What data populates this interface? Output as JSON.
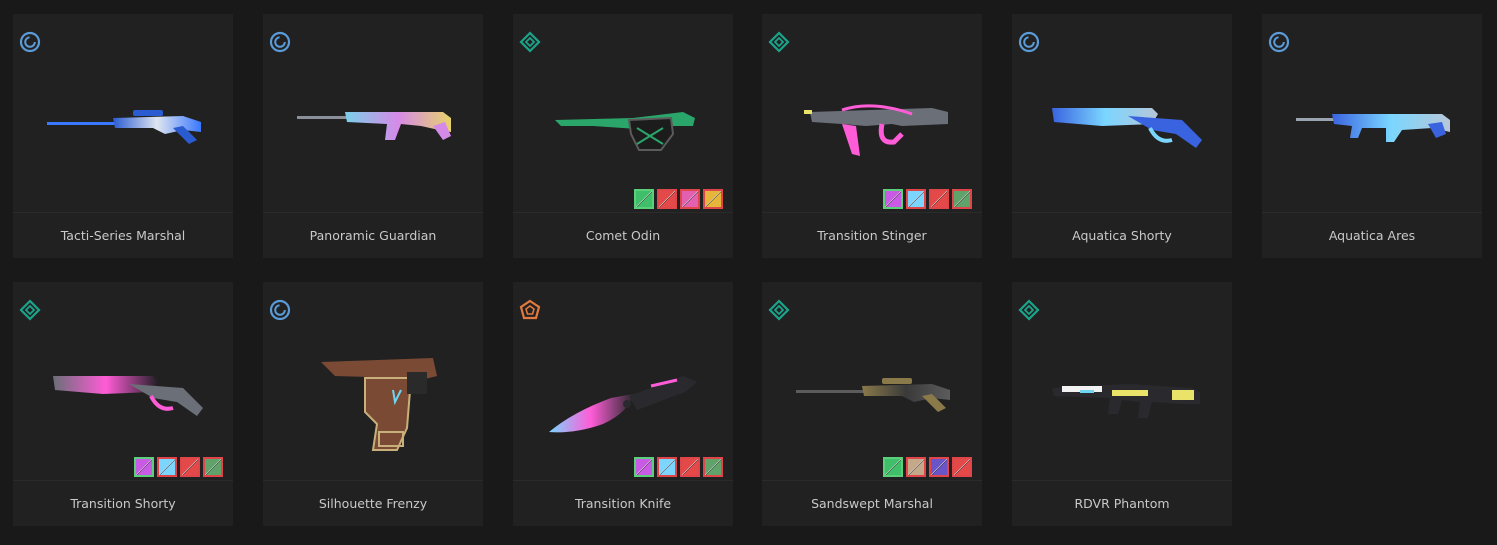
{
  "colors": {
    "background": "#1a1919",
    "card": "#222122",
    "tier_deluxe": "#5a9bd8",
    "tier_select": "#1aa58a",
    "tier_exclusive": "#e07a3e"
  },
  "skins": [
    {
      "name": "Tacti-Series Marshal",
      "tier_icon": "deluxe-tier-icon",
      "weapon_icon": "marshal-icon",
      "palette": [
        "#2a5bd0",
        "#dfe5f0",
        "#3a78ff"
      ],
      "swatches": []
    },
    {
      "name": "Panoramic Guardian",
      "tier_icon": "deluxe-tier-icon",
      "weapon_icon": "guardian-icon",
      "palette": [
        "#7ad0e8",
        "#d68ae8",
        "#e7d26a"
      ],
      "swatches": []
    },
    {
      "name": "Comet Odin",
      "tier_icon": "select-tier-icon",
      "weapon_icon": "odin-icon",
      "palette": [
        "#2aa66b",
        "#5b5b5b",
        "#1c1c1c"
      ],
      "swatches": [
        "#3fbf6a",
        "#e34949",
        "#e35fb0",
        "#e6b63a"
      ]
    },
    {
      "name": "Transition Stinger",
      "tier_icon": "select-tier-icon",
      "weapon_icon": "stinger-icon",
      "palette": [
        "#6a6f78",
        "#ff5cd7",
        "#1e1e22"
      ],
      "swatches": [
        "#c95ae5",
        "#7bd5ff",
        "#e34949",
        "#5fa26a"
      ]
    },
    {
      "name": "Aquatica Shorty",
      "tier_icon": "deluxe-tier-icon",
      "weapon_icon": "shorty-icon",
      "palette": [
        "#3a63e0",
        "#7ad6ff",
        "#b7c6d8"
      ],
      "swatches": []
    },
    {
      "name": "Aquatica Ares",
      "tier_icon": "deluxe-tier-icon",
      "weapon_icon": "ares-icon",
      "palette": [
        "#3a63e0",
        "#7ad6ff",
        "#b7c6d8"
      ],
      "swatches": []
    },
    {
      "name": "Transition Shorty",
      "tier_icon": "select-tier-icon",
      "weapon_icon": "shorty-icon",
      "palette": [
        "#6a6f78",
        "#ff5cd7",
        "#1e1e22"
      ],
      "swatches": [
        "#c95ae5",
        "#7bd5ff",
        "#e34949",
        "#5fa26a"
      ]
    },
    {
      "name": "Silhouette Frenzy",
      "tier_icon": "deluxe-tier-icon",
      "weapon_icon": "frenzy-icon",
      "palette": [
        "#7a4a35",
        "#c8b07a",
        "#2a2a2a"
      ],
      "swatches": []
    },
    {
      "name": "Transition Knife",
      "tier_icon": "exclusive-tier-icon",
      "weapon_icon": "knife-icon",
      "palette": [
        "#7ad6ff",
        "#ff5cd7",
        "#2a2a2e"
      ],
      "swatches": [
        "#c95ae5",
        "#7bd5ff",
        "#e34949",
        "#5fa26a"
      ]
    },
    {
      "name": "Sandswept Marshal",
      "tier_icon": "select-tier-icon",
      "weapon_icon": "marshal-icon",
      "palette": [
        "#8a7a4a",
        "#3a3a3a",
        "#5c5c5c"
      ],
      "swatches": [
        "#3fbf6a",
        "#c4a88a",
        "#6a55c8",
        "#e34949"
      ]
    },
    {
      "name": "RDVR Phantom",
      "tier_icon": "select-tier-icon",
      "weapon_icon": "phantom-icon",
      "palette": [
        "#e9e36a",
        "#f2f2f2",
        "#6fd5f0"
      ],
      "swatches": []
    }
  ]
}
